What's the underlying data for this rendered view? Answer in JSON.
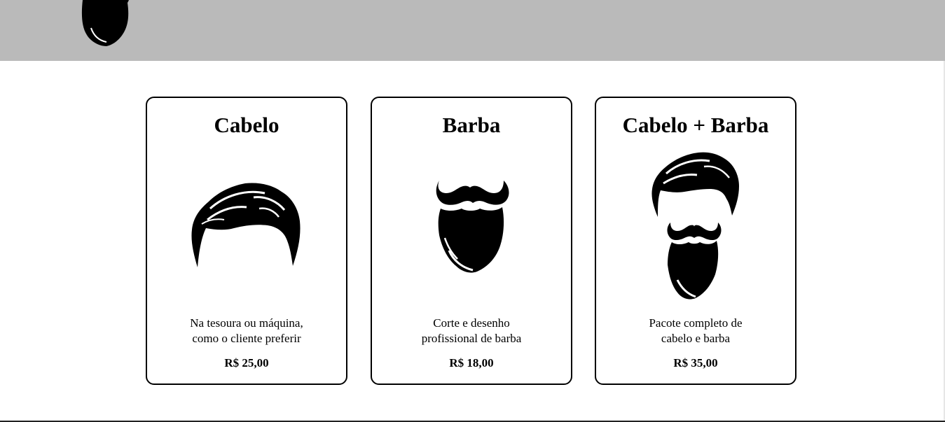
{
  "header": {
    "logo_icon": "beard-icon",
    "background": "#bababa"
  },
  "services": [
    {
      "title": "Cabelo",
      "icon": "hair-icon",
      "description_line1": "Na tesoura ou máquina,",
      "description_line2": "como o cliente preferir",
      "price": "R$ 25,00"
    },
    {
      "title": "Barba",
      "icon": "beard-icon",
      "description_line1": "Corte e desenho",
      "description_line2": "profissional de barba",
      "price": "R$ 18,00"
    },
    {
      "title": "Cabelo + Barba",
      "icon": "hair-and-beard-icon",
      "description_line1": "Pacote completo de",
      "description_line2": "cabelo e barba",
      "price": "R$ 35,00"
    }
  ]
}
